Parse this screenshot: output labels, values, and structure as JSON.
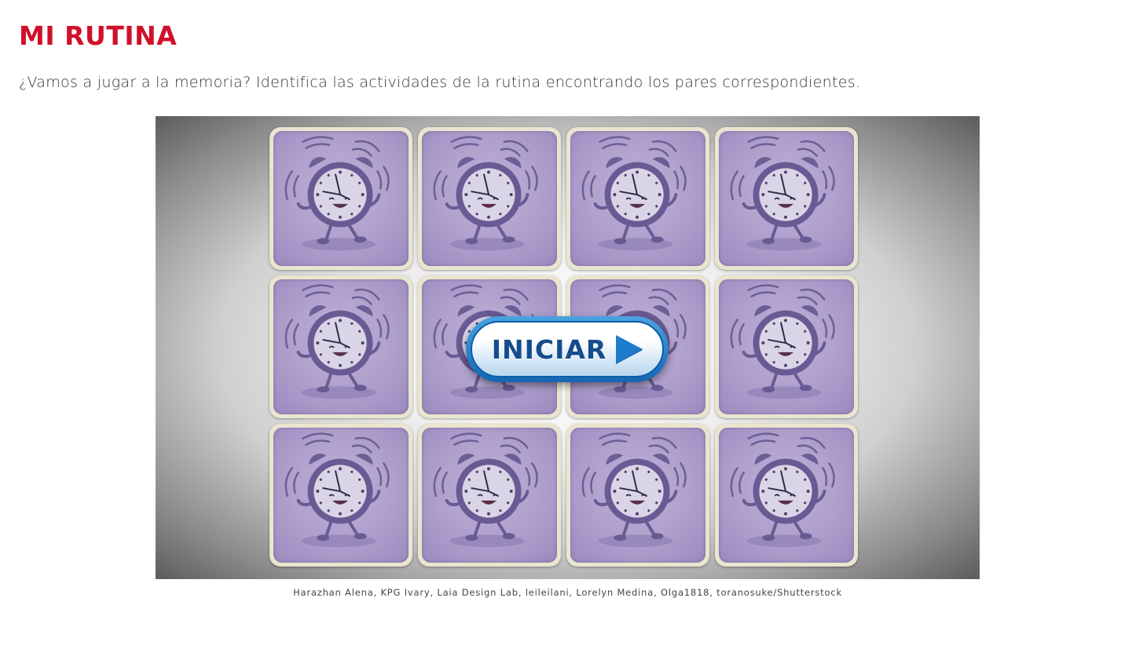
{
  "title": "MI RUTINA",
  "instructions": "¿Vamos a jugar a la memoria? Identifica las actividades de la rutina encontrando los pares correspondientes.",
  "game": {
    "card_icon": "alarm-clock-character-icon",
    "cards": [
      {
        "state": "face-down"
      },
      {
        "state": "face-down"
      },
      {
        "state": "face-down"
      },
      {
        "state": "face-down"
      },
      {
        "state": "face-down"
      },
      {
        "state": "face-down"
      },
      {
        "state": "face-down"
      },
      {
        "state": "face-down"
      },
      {
        "state": "face-down"
      },
      {
        "state": "face-down"
      },
      {
        "state": "face-down"
      },
      {
        "state": "face-down"
      }
    ],
    "start_button": {
      "label": "INICIAR",
      "icon": "play-icon"
    }
  },
  "credits": "Harazhan Alena, KPG Ivary, Laia Design Lab, leileilani, Lorelyn Medina, Olga1818, toranosuke/Shutterstock",
  "colors": {
    "title": "#d0102a",
    "card_back": "#a898c8",
    "button_blue": "#1466b4"
  }
}
